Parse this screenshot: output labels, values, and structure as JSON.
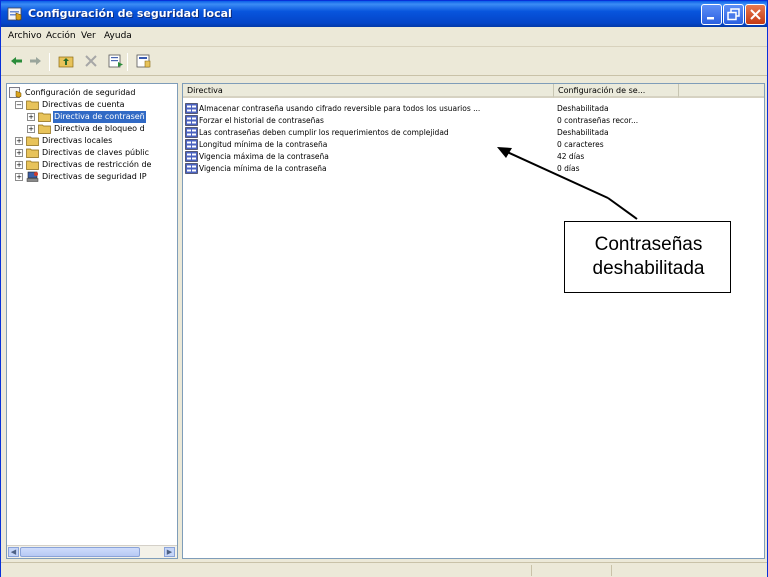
{
  "window": {
    "title": "Configuración de seguridad local",
    "controls": [
      "minimize-icon",
      "maximize-icon",
      "close-icon"
    ]
  },
  "menubar": {
    "items": [
      "Archivo",
      "Acción",
      "Ver",
      "Ayuda"
    ]
  },
  "toolbar": {
    "icons": [
      "back-arrow-icon",
      "forward-arrow-icon",
      "up-folder-icon",
      "delete-x-icon",
      "export-list-icon",
      "properties-icon"
    ]
  },
  "tree": {
    "items": [
      {
        "label": "Configuración de seguridad",
        "icon": "security-settings-icon",
        "expander": ""
      },
      {
        "label": "Directivas de cuenta",
        "icon": "folder-icon",
        "expander": "−"
      },
      {
        "label": "Directiva de contraseñ",
        "icon": "folder-icon",
        "expander": "+",
        "selected": true
      },
      {
        "label": "Directiva de bloqueo d",
        "icon": "folder-icon",
        "expander": "+"
      },
      {
        "label": "Directivas locales",
        "icon": "folder-icon",
        "expander": "+"
      },
      {
        "label": "Directivas de claves públic",
        "icon": "folder-icon",
        "expander": "+"
      },
      {
        "label": "Directivas de restricción de",
        "icon": "folder-icon",
        "expander": "+"
      },
      {
        "label": "Directivas de seguridad IP",
        "icon": "ip-security-icon",
        "expander": "+"
      }
    ]
  },
  "list": {
    "columns": [
      "Directiva",
      "Configuración de se..."
    ],
    "rows": [
      {
        "policy": "Almacenar contraseña usando cifrado reversible para todos los usuarios ...",
        "value": "Deshabilitada"
      },
      {
        "policy": "Forzar el historial de contraseñas",
        "value": "0 contraseñas recor..."
      },
      {
        "policy": "Las contraseñas deben cumplir los requerimientos de complejidad",
        "value": "Deshabilitada"
      },
      {
        "policy": "Longitud mínima de la contraseña",
        "value": "0 caracteres"
      },
      {
        "policy": "Vigencia máxima de la contraseña",
        "value": "42 días"
      },
      {
        "policy": "Vigencia mínima de la contraseña",
        "value": "0 días"
      }
    ]
  },
  "callout": {
    "line1": "Contraseñas",
    "line2": "deshabilitada"
  },
  "colors": {
    "titlebar": "#0855dd",
    "selection": "#316ac5",
    "window_bg": "#ece9d8"
  }
}
